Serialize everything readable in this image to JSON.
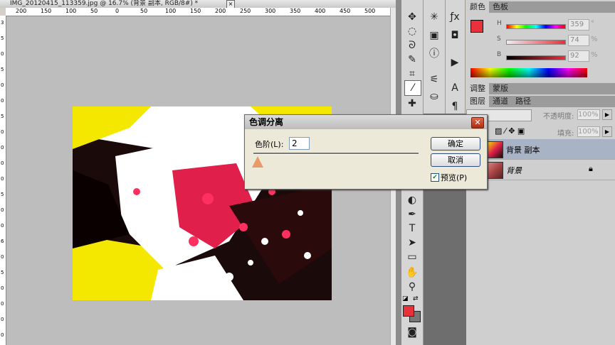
{
  "document": {
    "title": "IMG_20120415_113359.jpg @ 16.7% (背景 副本, RGB/8#) *",
    "close_glyph": "×",
    "ruler_marks": [
      "200",
      "150",
      "100",
      "50",
      "0",
      "50",
      "100",
      "150",
      "200",
      "250",
      "300",
      "350",
      "400",
      "450",
      "500"
    ],
    "vruler_marks": [
      "3",
      "5",
      "0",
      "5",
      "0",
      "0",
      "5",
      "0",
      "0",
      "0",
      "0",
      "5",
      "0",
      "0",
      "6",
      "0",
      "5",
      "0",
      "0",
      "0",
      "0"
    ]
  },
  "tools": {
    "left_icons": [
      "move-icon",
      "marquee-icon",
      "lasso-icon",
      "quick-select-icon",
      "crop-icon",
      "eyedropper-icon",
      "healing-icon",
      "brush-icon",
      "pen-icon",
      "type-icon",
      "path-select-icon",
      "shape-icon",
      "hand-icon",
      "zoom-icon"
    ],
    "text_tool_label": "T",
    "foreground_color": "#e8313b",
    "background_color": "#777777"
  },
  "color_panel": {
    "tabs": [
      "颜色",
      "色板"
    ],
    "h": {
      "label": "H",
      "value": "359",
      "unit": "°"
    },
    "s": {
      "label": "S",
      "value": "74",
      "unit": "%"
    },
    "b": {
      "label": "B",
      "value": "92",
      "unit": "%"
    }
  },
  "adjust_panel": {
    "tabs": [
      "调整",
      "蒙版"
    ]
  },
  "layers_panel": {
    "tabs": [
      "图层",
      "通道",
      "路径"
    ],
    "opacity_label": "不透明度:",
    "opacity_value": "100%",
    "fill_label": "填充:",
    "fill_value": "100%",
    "layers": [
      {
        "name": "背景 副本",
        "selected": true
      },
      {
        "name": "背景",
        "locked": true
      }
    ]
  },
  "dialog": {
    "title": "色调分离",
    "close_glyph": "✕",
    "level_label": "色阶(L):",
    "level_value": "2",
    "ok_label": "确定",
    "cancel_label": "取消",
    "preview_label": "预览(P)",
    "preview_checked": true
  }
}
